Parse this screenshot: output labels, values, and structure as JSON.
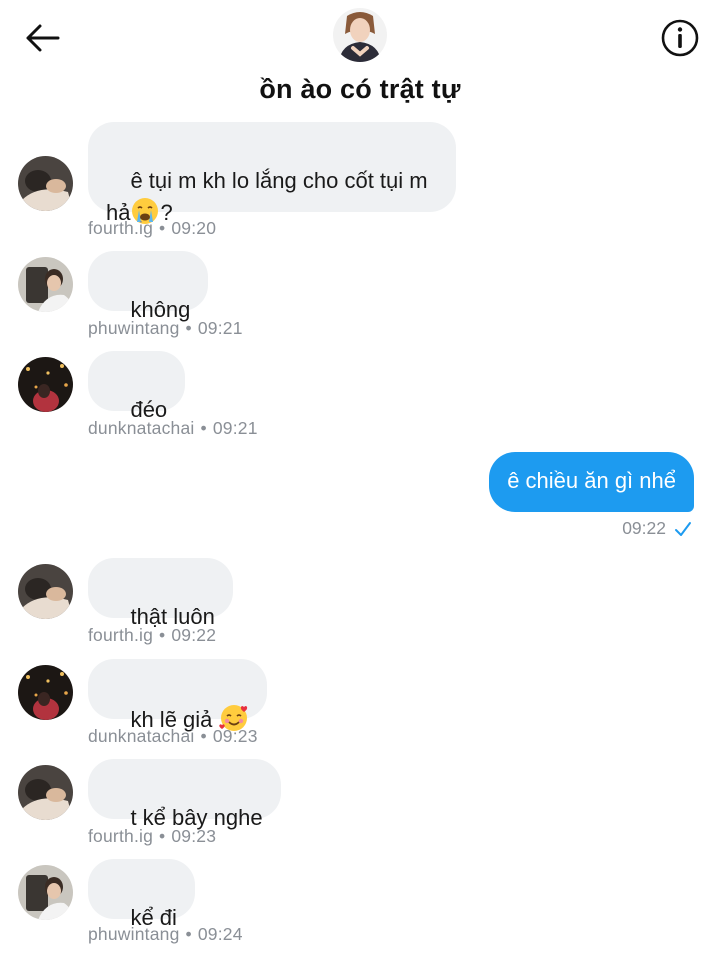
{
  "header": {
    "title": "ồn ào có trật tự",
    "back_icon": "arrow-left-icon",
    "info_icon": "info-icon"
  },
  "colors": {
    "outgoing_bubble": "#1d9bf0",
    "incoming_bubble": "#eff1f3",
    "meta_text": "#8a8f96",
    "read_check": "#1d9bf0"
  },
  "messages": [
    {
      "sender": "fourth.ig",
      "text": "ê tụi m kh lo lắng cho cốt tụi m\nhả",
      "emoji": "crying-face-emoji",
      "emoji_suffix": "?",
      "time": "09:20"
    },
    {
      "sender": "phuwintang",
      "text": "không",
      "time": "09:21"
    },
    {
      "sender": "dunknatachai",
      "text": "đéo",
      "time": "09:21"
    },
    {
      "sender": "",
      "text": "ê chiều ăn gì nhể",
      "time": "09:22",
      "outgoing": true
    },
    {
      "sender": "fourth.ig",
      "text": "thật luôn",
      "time": "09:22"
    },
    {
      "sender": "dunknatachai",
      "text": "kh lẽ giả ",
      "emoji": "smiling-hearts-emoji",
      "time": "09:23"
    },
    {
      "sender": "fourth.ig",
      "text": "t kể bây nghe",
      "time": "09:23"
    },
    {
      "sender": "phuwintang",
      "text": "kể đi",
      "time": "09:24"
    }
  ],
  "separator": "•"
}
